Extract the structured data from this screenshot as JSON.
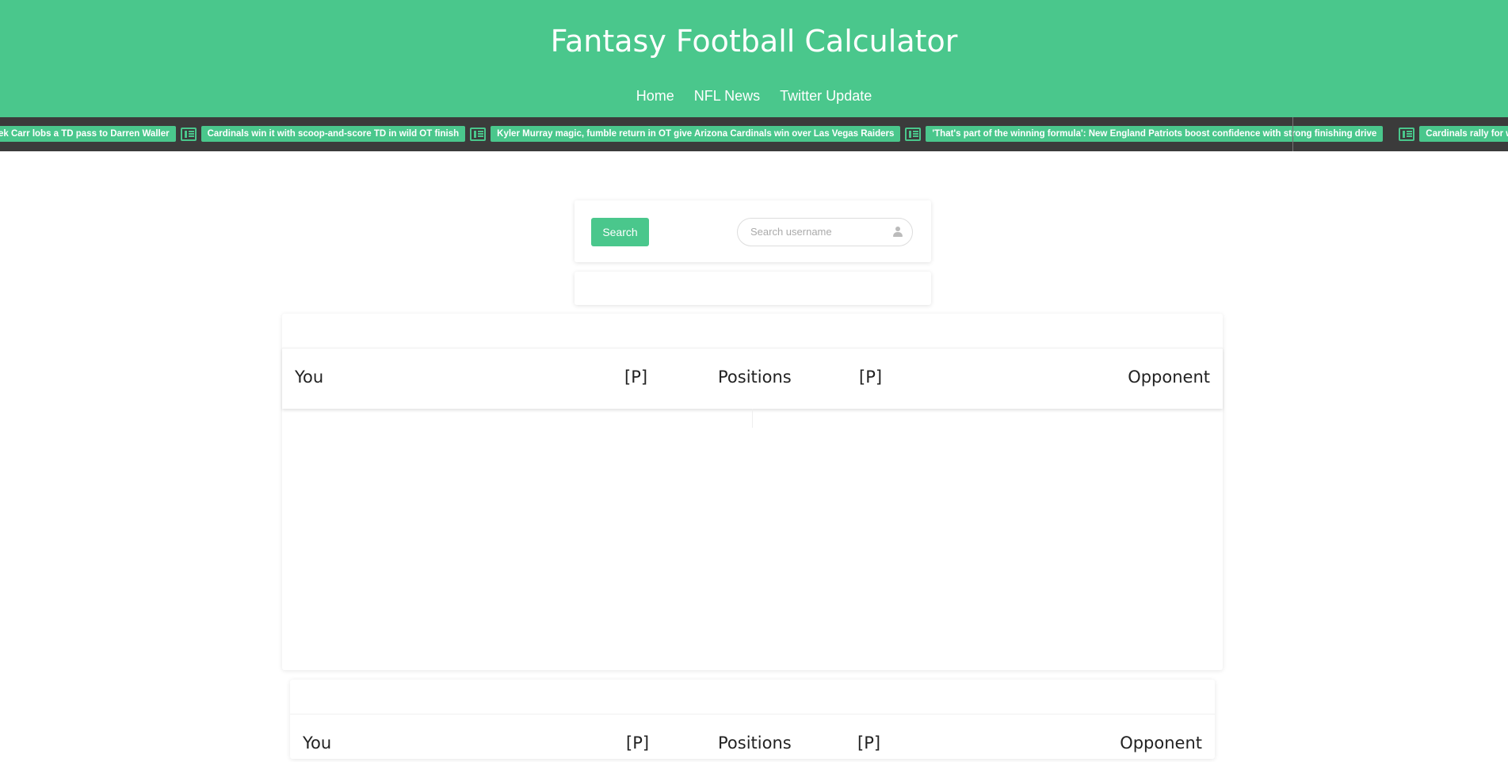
{
  "header": {
    "title": "Fantasy Football Calculator",
    "nav": [
      "Home",
      "NFL News",
      "Twitter Update"
    ],
    "accent_color": "#4ac78c"
  },
  "ticker": {
    "icon": "newspaper-icon",
    "items": [
      "ek Carr lobs a TD pass to Darren Waller",
      "Cardinals win it with scoop-and-score TD in wild OT finish",
      "Kyler Murray magic, fumble return in OT give Arizona Cardinals win over Las Vegas Raiders",
      "'That's part of the winning formula': New England Patriots boost confidence with strong finishing drive",
      "Cardinals rally for wild comeback win in OT"
    ]
  },
  "search": {
    "button_label": "Search",
    "placeholder": "Search username"
  },
  "matchup": {
    "you": "You",
    "p_left": "[P]",
    "positions": "Positions",
    "p_right": "[P]",
    "opponent": "Opponent"
  }
}
